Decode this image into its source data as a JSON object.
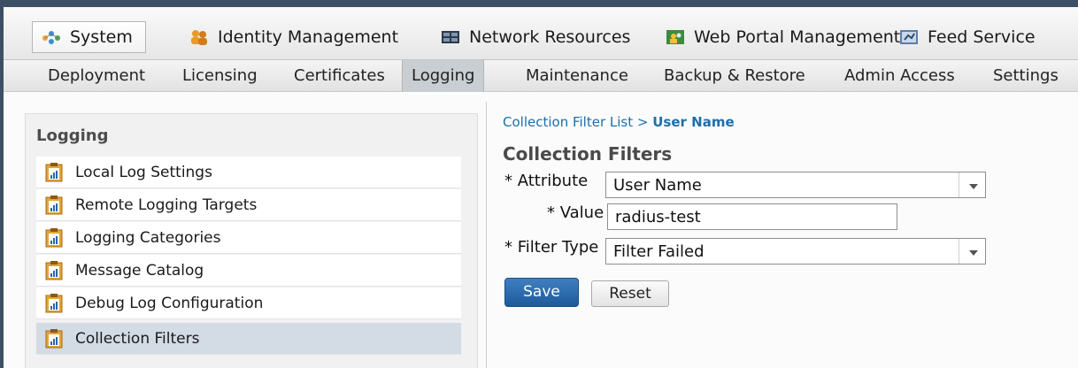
{
  "top_tabs": [
    {
      "label": "System",
      "icon": "system-icon"
    },
    {
      "label": "Identity Management",
      "icon": "identity-icon"
    },
    {
      "label": "Network Resources",
      "icon": "network-icon"
    },
    {
      "label": "Web Portal Management",
      "icon": "portal-icon"
    },
    {
      "label": "Feed Service",
      "icon": "feed-icon"
    }
  ],
  "sub_tabs": [
    {
      "label": "Deployment"
    },
    {
      "label": "Licensing"
    },
    {
      "label": "Certificates"
    },
    {
      "label": "Logging"
    },
    {
      "label": "Maintenance"
    },
    {
      "label": "Backup & Restore"
    },
    {
      "label": "Admin Access"
    },
    {
      "label": "Settings"
    }
  ],
  "sidebar": {
    "title": "Logging",
    "items": [
      {
        "label": "Local Log Settings"
      },
      {
        "label": "Remote Logging Targets"
      },
      {
        "label": "Logging Categories"
      },
      {
        "label": "Message Catalog"
      },
      {
        "label": "Debug Log Configuration"
      },
      {
        "label": "Collection Filters"
      }
    ]
  },
  "breadcrumb": {
    "parent": "Collection Filter List",
    "separator": ">",
    "current": "User Name"
  },
  "form": {
    "title": "Collection Filters",
    "attribute_label": "* Attribute",
    "attribute_value": "User Name",
    "value_label": "* Value",
    "value_value": "radius-test",
    "filter_type_label": "* Filter Type",
    "filter_type_value": "Filter Failed",
    "save_label": "Save",
    "reset_label": "Reset"
  },
  "colors": {
    "accent": "#1d5a9c",
    "breadcrumb_link": "#1e6fa8",
    "selected_row": "#d3dbe5"
  }
}
